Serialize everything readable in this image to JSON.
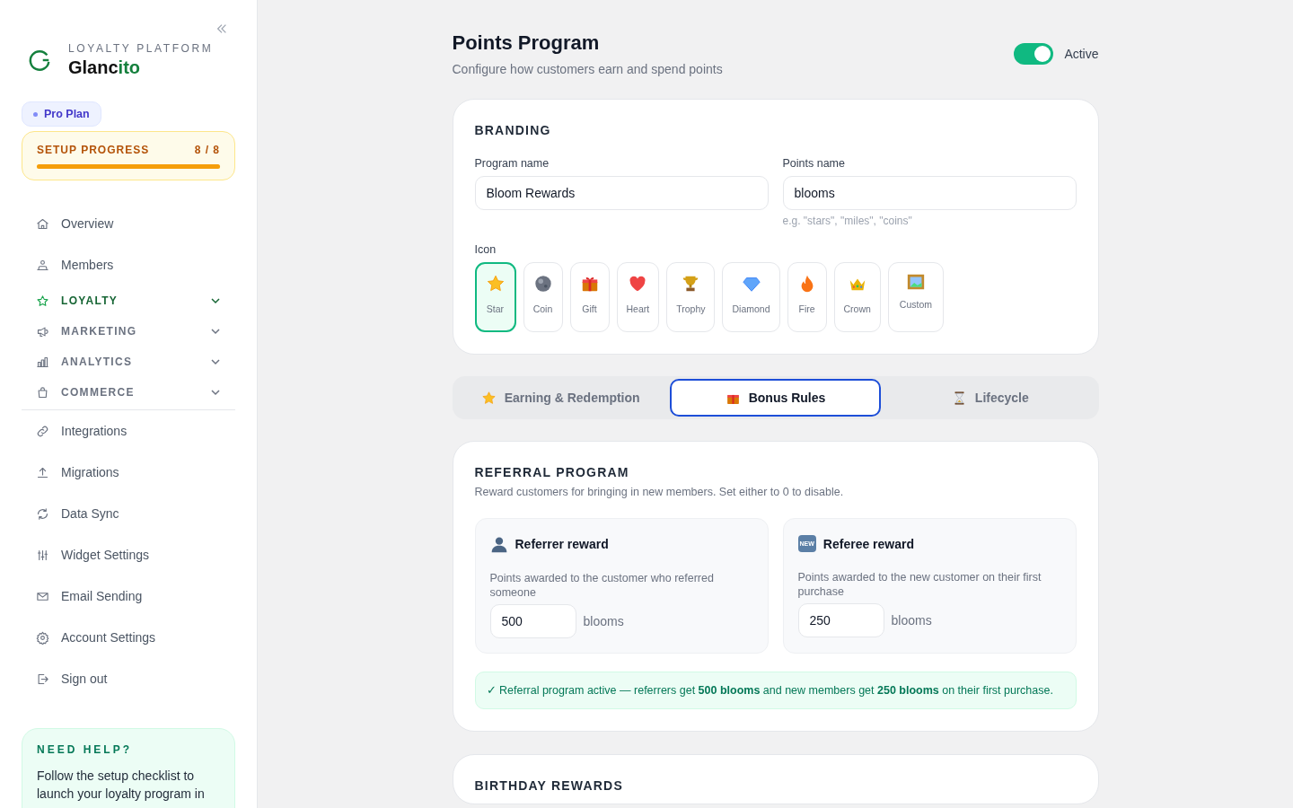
{
  "sidebar": {
    "brand": {
      "tagline": "LOYALTY PLATFORM",
      "name_main": "Glanc",
      "name_accent": "ito"
    },
    "plan": {
      "label": "Pro Plan"
    },
    "setup_progress": {
      "label": "SETUP PROGRESS",
      "count": "8 / 8",
      "level": 1
    },
    "nav": [
      {
        "kind": "link",
        "label": "Overview",
        "selected": false
      },
      {
        "kind": "link",
        "label": "Members",
        "selected": false
      },
      {
        "kind": "group",
        "label": "LOYALTY",
        "selected": true,
        "expanded": false
      },
      {
        "kind": "group",
        "label": "MARKETING",
        "selected": false,
        "expanded": false
      },
      {
        "kind": "group",
        "label": "ANALYTICS",
        "selected": false,
        "expanded": false
      },
      {
        "kind": "group",
        "label": "COMMERCE",
        "selected": false,
        "expanded": false
      },
      {
        "kind": "link",
        "label": "Integrations",
        "selected": false
      },
      {
        "kind": "link",
        "label": "Migrations",
        "selected": false
      },
      {
        "kind": "link",
        "label": "Data Sync",
        "selected": false
      },
      {
        "kind": "link",
        "label": "Widget Settings",
        "selected": false
      },
      {
        "kind": "link",
        "label": "Email Sending",
        "selected": false
      },
      {
        "kind": "link",
        "label": "Account Settings",
        "selected": false
      },
      {
        "kind": "link",
        "label": "Sign out",
        "selected": false
      }
    ],
    "help": {
      "title": "NEED HELP?",
      "text": "Follow the setup checklist to launch your loyalty program in"
    }
  },
  "header": {
    "title": "Points Program",
    "subtitle": "Configure how customers earn and spend points",
    "toggle": {
      "on": true,
      "label": "Active"
    }
  },
  "branding": {
    "title": "BRANDING",
    "program_name": {
      "label": "Program name",
      "value": "Bloom Rewards"
    },
    "points_name": {
      "label": "Points name",
      "value": "blooms",
      "hint": "e.g. \"stars\", \"miles\", \"coins\""
    },
    "icon_label": "Icon",
    "icons": [
      {
        "label": "Star",
        "selected": true
      },
      {
        "label": "Coin",
        "selected": false
      },
      {
        "label": "Gift",
        "selected": false
      },
      {
        "label": "Heart",
        "selected": false
      },
      {
        "label": "Trophy",
        "selected": false
      },
      {
        "label": "Diamond",
        "selected": false
      },
      {
        "label": "Fire",
        "selected": false
      },
      {
        "label": "Crown",
        "selected": false
      },
      {
        "label": "Custom",
        "selected": false
      }
    ]
  },
  "tabs": [
    {
      "label": "Earning & Redemption",
      "selected": false
    },
    {
      "label": "Bonus Rules",
      "selected": true
    },
    {
      "label": "Lifecycle",
      "selected": false
    }
  ],
  "referral": {
    "title": "REFERRAL PROGRAM",
    "subtitle": "Reward customers for bringing in new members. Set either to 0 to disable.",
    "rewards": [
      {
        "title": "Referrer reward",
        "description": "Points awarded to the customer who referred someone",
        "value": "500",
        "unit": "blooms"
      },
      {
        "title": "Referee reward",
        "badge": "NEW",
        "description": "Points awarded to the new customer on their first purchase",
        "value": "250",
        "unit": "blooms"
      }
    ],
    "notice": "✓ Referral program active — referrers get **500 blooms** and new members get **250 blooms** on their first purchase."
  },
  "next_section": {
    "title": "BIRTHDAY REWARDS"
  }
}
